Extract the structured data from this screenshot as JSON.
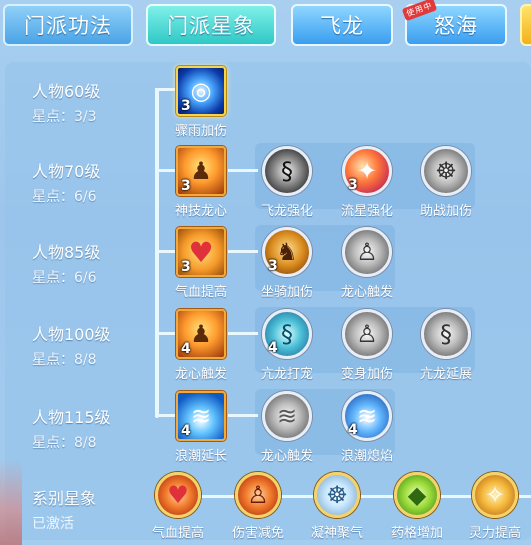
{
  "tabs": [
    {
      "label": "门派功法"
    },
    {
      "label": "门派星象"
    },
    {
      "label": "飞龙"
    },
    {
      "label": "怒海",
      "badge": "使用中"
    },
    {
      "label": ""
    }
  ],
  "rows": [
    {
      "level": "人物60级",
      "points": "星点：3/3",
      "nodes": [
        {
          "label": "骤雨加伤",
          "count": "3",
          "icon": "rain-swirl-icon"
        }
      ]
    },
    {
      "level": "人物70级",
      "points": "星点：6/6",
      "nodes": [
        {
          "label": "神技龙心",
          "count": "3",
          "icon": "dragon-heart-icon"
        },
        {
          "label": "飞龙强化",
          "count": "",
          "icon": "black-dragon-icon"
        },
        {
          "label": "流星强化",
          "count": "3",
          "icon": "meteor-icon"
        },
        {
          "label": "助战加伤",
          "count": "",
          "icon": "meditation-icon"
        }
      ]
    },
    {
      "level": "人物85级",
      "points": "星点：6/6",
      "nodes": [
        {
          "label": "气血提高",
          "count": "3",
          "icon": "heart-icon"
        },
        {
          "label": "坐骑加伤",
          "count": "3",
          "icon": "mount-icon"
        },
        {
          "label": "龙心触发",
          "count": "",
          "icon": "figure-icon"
        }
      ]
    },
    {
      "level": "人物100级",
      "points": "星点：8/8",
      "nodes": [
        {
          "label": "龙心触发",
          "count": "4",
          "icon": "dragon-heart-icon"
        },
        {
          "label": "亢龙打宠",
          "count": "4",
          "icon": "cyan-dragon-icon"
        },
        {
          "label": "变身加伤",
          "count": "",
          "icon": "figure-icon"
        },
        {
          "label": "亢龙延展",
          "count": "",
          "icon": "grey-dragon-icon"
        }
      ]
    },
    {
      "level": "人物115级",
      "points": "星点：8/8",
      "nodes": [
        {
          "label": "浪潮延长",
          "count": "4",
          "icon": "wave-icon"
        },
        {
          "label": "龙心触发",
          "count": "",
          "icon": "grey-wave-icon"
        },
        {
          "label": "浪潮熄焰",
          "count": "4",
          "icon": "blue-wave-icon"
        }
      ]
    }
  ],
  "series": {
    "title": "系别星象",
    "status": "已激活",
    "items": [
      {
        "label": "气血提高",
        "icon": "heart-icon"
      },
      {
        "label": "伤害减免",
        "icon": "armor-figure-icon"
      },
      {
        "label": "凝神聚气",
        "icon": "meditation-icon"
      },
      {
        "label": "药格增加",
        "icon": "gem-icon"
      },
      {
        "label": "灵力提高",
        "icon": "sparkle-icon"
      }
    ]
  }
}
